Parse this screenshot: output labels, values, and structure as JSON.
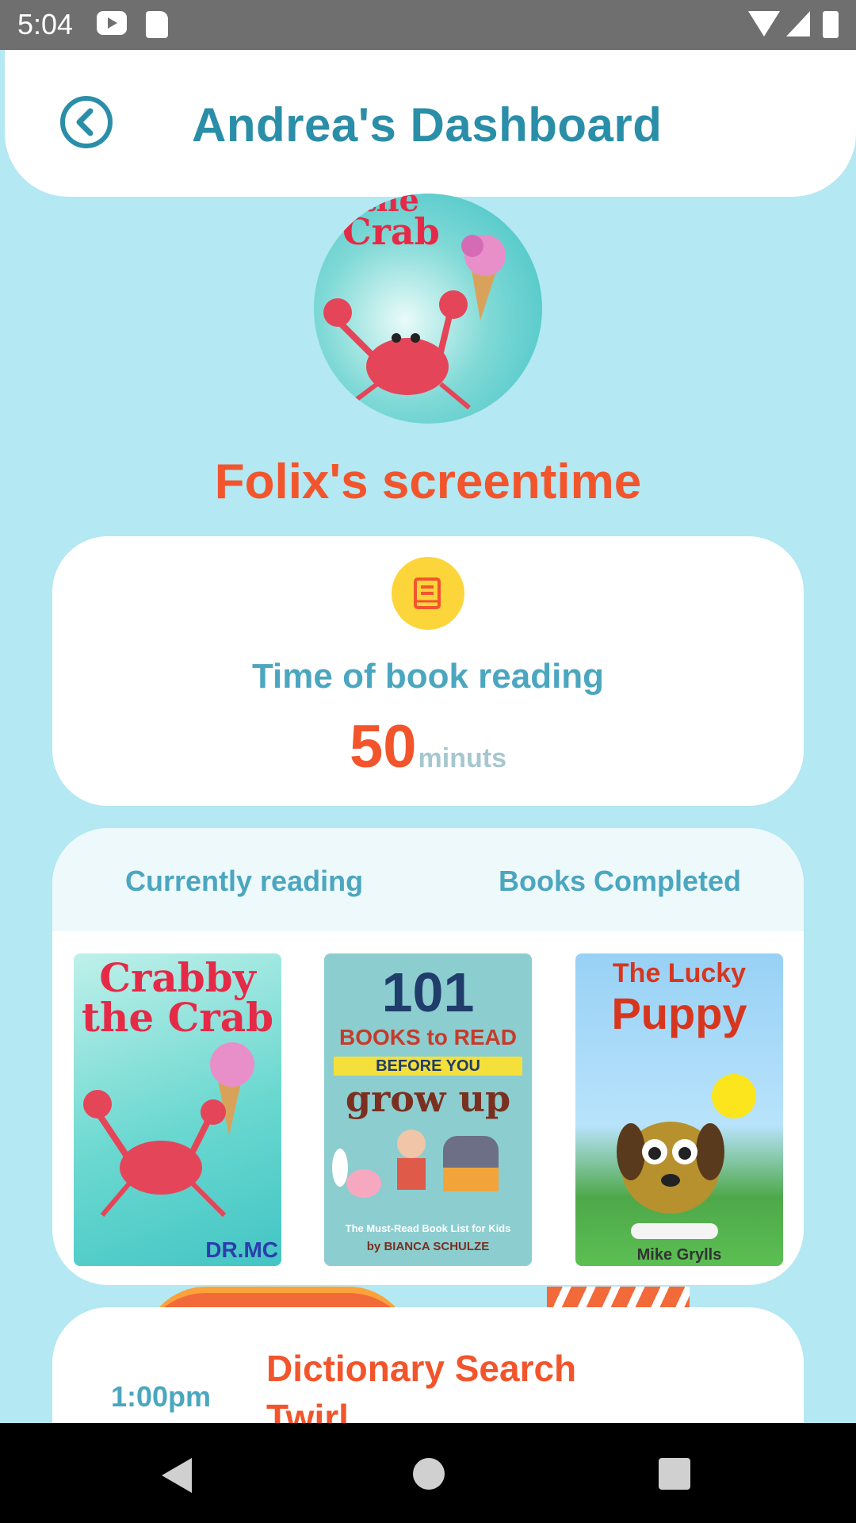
{
  "status_bar": {
    "time": "5:04",
    "icons": [
      "youtube-icon",
      "sd-card-icon",
      "wifi-icon",
      "signal-icon",
      "battery-icon"
    ]
  },
  "header": {
    "title": "Andrea's Dashboard",
    "back_icon": "chevron-left-circle-icon"
  },
  "profile": {
    "avatar_icon": "crab-avatar",
    "screentime_title": "Folix's screentime"
  },
  "reading": {
    "icon": "book-icon",
    "label": "Time of book reading",
    "minutes": "50",
    "unit": "minuts"
  },
  "books": {
    "tabs": [
      {
        "label": "Currently reading"
      },
      {
        "label": "Books Completed"
      }
    ],
    "covers": [
      {
        "title_line1": "Crabby the Crab",
        "author": "DR.MC"
      },
      {
        "number": "101",
        "line1": "BOOKS to READ",
        "line2": "BEFORE YOU",
        "line3": "grow up",
        "subtitle": "The Must-Read Book List for Kids",
        "author": "by BIANCA SCHULZE"
      },
      {
        "title_line1": "The Lucky",
        "title_line2": "Puppy",
        "author": "Mike Grylls"
      }
    ]
  },
  "schedule": {
    "time": "1:00pm",
    "title": "Dictionary Search Twirl"
  },
  "colors": {
    "background": "#b4e8f3",
    "primary_teal": "#2a8ea8",
    "accent_orange": "#f2552c",
    "muted_teal": "#4ba6bf",
    "icon_yellow": "#fcd53b"
  }
}
